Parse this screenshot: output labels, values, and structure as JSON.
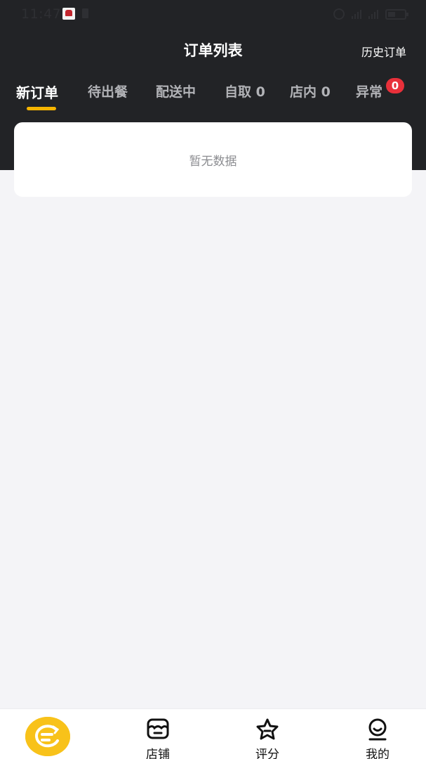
{
  "status_bar": {
    "time": "11:47",
    "icons": [
      "app-notification-icon",
      "sim-icon",
      "alarm-icon",
      "signal-icon",
      "signal-icon",
      "battery-icon"
    ],
    "network_labels": [
      "4G",
      "4G"
    ]
  },
  "nav": {
    "title": "订单列表",
    "history_label": "历史订单"
  },
  "tabs": [
    {
      "label": "新订单",
      "active": true
    },
    {
      "label": "待出餐"
    },
    {
      "label": "配送中"
    },
    {
      "label": "自取 0"
    },
    {
      "label": "店内 0"
    },
    {
      "label": "异常",
      "badge": "0"
    }
  ],
  "content": {
    "empty_text": "暂无数据"
  },
  "bottom_bar": {
    "items": [
      {
        "label": "",
        "icon": "orders-icon",
        "active": true
      },
      {
        "label": "店铺",
        "icon": "store-icon"
      },
      {
        "label": "评分",
        "icon": "star-icon"
      },
      {
        "label": "我的",
        "icon": "profile-icon"
      }
    ]
  },
  "colors": {
    "header_bg": "#222326",
    "accent": "#f7b500",
    "badge": "#e8303a",
    "page_bg": "#f4f4f7"
  }
}
